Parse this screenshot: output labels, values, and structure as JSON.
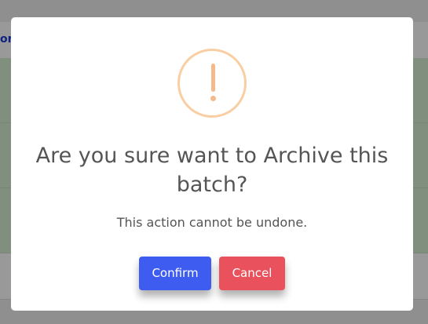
{
  "background": {
    "header_link": "or"
  },
  "dialog": {
    "icon": "exclamation-icon",
    "title": "Are you sure want to Archive this batch?",
    "message": "This action cannot be undone.",
    "confirm_label": "Confirm",
    "cancel_label": "Cancel"
  },
  "colors": {
    "confirm": "#3f5cf0",
    "cancel": "#e9525c",
    "warning_icon": "#f6b98a",
    "background_row": "#d7f0d3"
  }
}
